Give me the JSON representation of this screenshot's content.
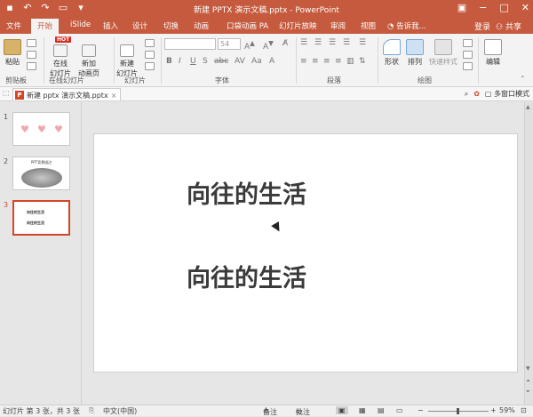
{
  "window": {
    "title": "新建 PPTX 演示文稿.pptx - PowerPoint",
    "qat": [
      "save-icon",
      "undo-icon",
      "redo-icon",
      "present-icon",
      "customize-icon"
    ]
  },
  "tabs": [
    "文件",
    "开始",
    "iSlide",
    "插入",
    "设计",
    "切换",
    "动画",
    "口袋动画 PA",
    "幻灯片放映",
    "审阅",
    "视图"
  ],
  "active_tab": "开始",
  "tell_me": "告诉我...",
  "login": "登录",
  "share": "共享",
  "ribbon": {
    "paste": "粘贴",
    "clipboard": "剪贴板",
    "hot_badge": "HOT",
    "online_slides": [
      "在线",
      "幻灯片"
    ],
    "new_anim_page": [
      "新加",
      "动画页"
    ],
    "online_group": "在线幻灯片",
    "new_slide": [
      "新建",
      "幻灯片"
    ],
    "slides_group": "幻灯片",
    "font_size": "54",
    "font_group": "字体",
    "para_group": "段落",
    "shape": "形状",
    "arrange": "排列",
    "quick_styles": "快速样式",
    "drawing_group": "绘图",
    "edit": "编辑"
  },
  "doc": {
    "tab_label": "新建 pptx 演示文稿.pptx",
    "multiwindow": "多窗口模式"
  },
  "thumbnails": {
    "numbers": [
      "1",
      "2",
      "3"
    ],
    "slide2_title": "PPT背景描边",
    "slide3_lines": [
      "向往的生活",
      "向往的生活"
    ]
  },
  "slide": {
    "line1": "向往的生活",
    "line2": "向往的生活"
  },
  "status": {
    "slide_info": "幻灯片 第 3 张，共 3 张",
    "language": "中文(中国)",
    "notes": "备注",
    "comments": "批注",
    "zoom": "59%"
  },
  "colors": {
    "accent": "#c55a3e",
    "heart": "#f0a7ad"
  }
}
